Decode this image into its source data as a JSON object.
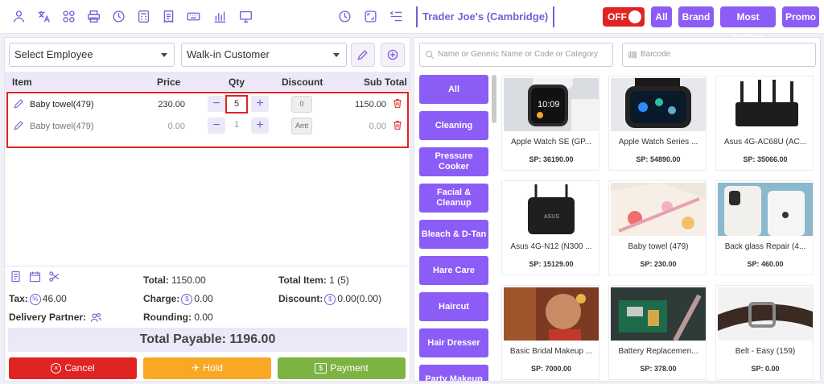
{
  "store_name": "Trader Joe's (Cambridge)",
  "toggle": {
    "label": "OFF"
  },
  "filters": {
    "all": "All",
    "brand": "Brand",
    "most_selling": "Most Selling",
    "promo": "Promo"
  },
  "order": {
    "employee_select": "Select Employee",
    "customer_select": "Walk-in Customer",
    "columns": {
      "item": "Item",
      "price": "Price",
      "qty": "Qty",
      "discount": "Discount",
      "subtotal": "Sub Total"
    },
    "rows": [
      {
        "name": "Baby towel(479)",
        "price": "230.00",
        "qty": "5",
        "discount": "0",
        "subtotal": "1150.00"
      },
      {
        "name": "Baby towel(479)",
        "price": "0.00",
        "qty": "1",
        "discount": "Amt",
        "subtotal": "0.00"
      }
    ]
  },
  "summary": {
    "total_label": "Total:",
    "total_value": "1150.00",
    "total_item_label": "Total Item:",
    "total_item_value": "1 (5)",
    "tax_label": "Tax:",
    "tax_value": "46.00",
    "charge_label": "Charge:",
    "charge_value": "0.00",
    "discount_label": "Discount:",
    "discount_value": "0.00(0.00)",
    "delivery_label": "Delivery Partner:",
    "rounding_label": "Rounding:",
    "rounding_value": "0.00",
    "payable": "Total Payable: 1196.00"
  },
  "actions": {
    "cancel": "Cancel",
    "hold": "Hold",
    "payment": "Payment"
  },
  "search": {
    "placeholder": "Name or Generic Name or Code or Category",
    "barcode_placeholder": "Barcode"
  },
  "categories": [
    "All",
    "Cleaning",
    "Pressure Cooker",
    "Facial & Cleanup",
    "Bleach & D-Tan",
    "Hare Care",
    "Haircut",
    "Hair Dresser",
    "Party Makeup"
  ],
  "products": [
    {
      "name": "Apple Watch SE (GP...",
      "sp": "SP: 36190.00"
    },
    {
      "name": "Apple Watch Series ...",
      "sp": "SP: 54890.00"
    },
    {
      "name": "Asus 4G-AC68U (AC...",
      "sp": "SP: 35066.00"
    },
    {
      "name": "Asus 4G-N12 (N300 ...",
      "sp": "SP: 15129.00"
    },
    {
      "name": "Baby towel (479)",
      "sp": "SP: 230.00"
    },
    {
      "name": "Back glass Repair (4...",
      "sp": "SP: 460.00"
    },
    {
      "name": "Basic Bridal Makeup ...",
      "sp": "SP: 7000.00"
    },
    {
      "name": "Battery Replacemen...",
      "sp": "SP: 378.00"
    },
    {
      "name": "Belt - Easy (159)",
      "sp": "SP: 0.00"
    }
  ],
  "colors": {
    "accent": "#8b5cf6",
    "danger": "#e02323",
    "hold": "#f9a825",
    "payment": "#7cb342"
  }
}
